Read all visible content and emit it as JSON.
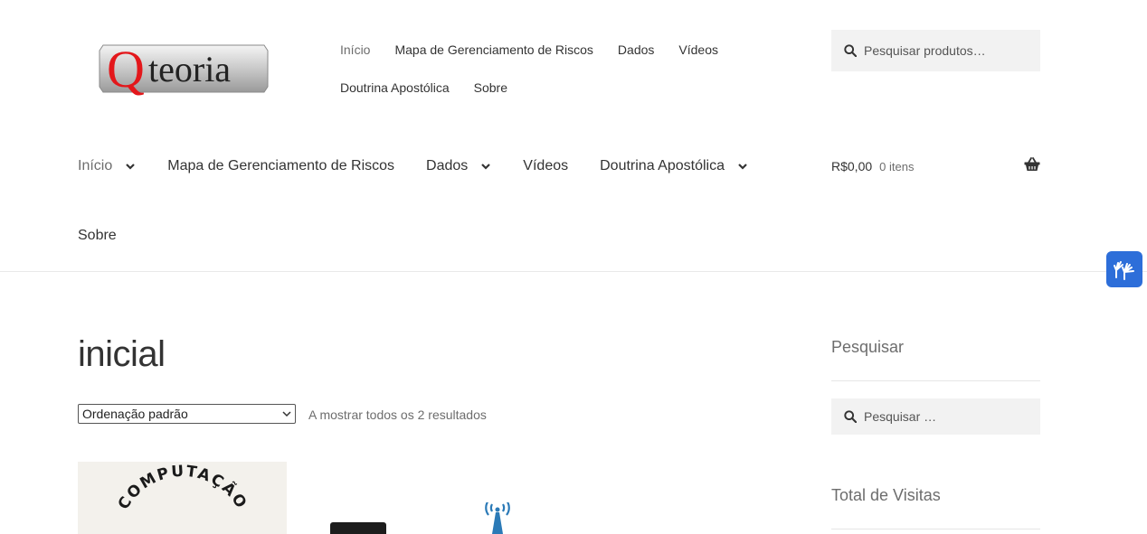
{
  "logo": {
    "text_q": "Q",
    "text_rest": "teoria"
  },
  "secondary_nav": {
    "row1": [
      "Início",
      "Mapa de Gerenciamento de Riscos",
      "Dados",
      "Vídeos"
    ],
    "row2": [
      "Doutrina Apostólica",
      "Sobre"
    ]
  },
  "header_search": {
    "placeholder": "Pesquisar produtos…"
  },
  "primary_nav": {
    "items": [
      {
        "label": "Início"
      },
      {
        "label": "Mapa de Gerenciamento de Riscos"
      },
      {
        "label": "Dados"
      },
      {
        "label": "Vídeos"
      },
      {
        "label": "Doutrina Apostólica"
      },
      {
        "label": "Sobre"
      }
    ]
  },
  "cart": {
    "amount": "R$0,00",
    "count": "0 itens"
  },
  "main": {
    "title": "inicial",
    "ordering_selected": "Ordenação padrão",
    "result_count": "A mostrar todos os 2 resultados",
    "product1_text": "COMPUTAÇÃO"
  },
  "sidebar": {
    "search_title": "Pesquisar",
    "search_placeholder": "Pesquisar …",
    "visits_title": "Total de Visitas"
  },
  "colors": {
    "accent_blue": "#2d6ed9",
    "logo_red": "#e3171b",
    "search_bg": "#f2f2f2"
  },
  "icons": [
    "search-icon",
    "chevron-down-icon",
    "basket-icon",
    "sign-language-hands-icon"
  ]
}
